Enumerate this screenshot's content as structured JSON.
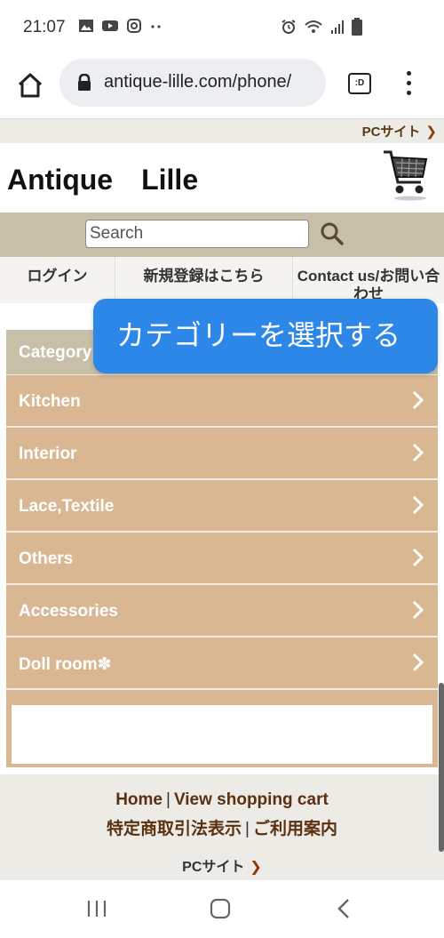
{
  "status_bar": {
    "time": "21:07",
    "left_icons": [
      "gallery-icon",
      "youtube-icon",
      "instagram-icon",
      "more-dots-icon"
    ],
    "right_icons": [
      "alarm-icon",
      "wifi-icon",
      "signal-icon",
      "battery-icon"
    ]
  },
  "browser": {
    "url": "antique-lille.com/phone/",
    "tab_label": ":D"
  },
  "page": {
    "pc_link": "PCサイト",
    "title": "Antique　Lille",
    "search": {
      "placeholder": "Search"
    },
    "nav": {
      "login": "ログイン",
      "register": "新規登録はこちら",
      "contact": "Contact us/お問い合わせ"
    },
    "category": {
      "header": "Category",
      "items": [
        {
          "label": "Kitchen"
        },
        {
          "label": "Interior"
        },
        {
          "label": "Lace,Textile"
        },
        {
          "label": "Others"
        },
        {
          "label": "Accessories"
        },
        {
          "label": "Doll room✽"
        }
      ]
    },
    "tooltip": "カテゴリーを選択する",
    "footer": {
      "home": "Home",
      "cart": "View shopping cart",
      "legal": "特定商取引法表示",
      "guide": "ご利用案内",
      "separator": "|",
      "pc_link": "PCサイト"
    }
  },
  "colors": {
    "category_bg": "#d9b793",
    "header_bar": "#c8bfa9",
    "tooltip_bg": "#2c87e8",
    "link_brown": "#5a3010"
  }
}
